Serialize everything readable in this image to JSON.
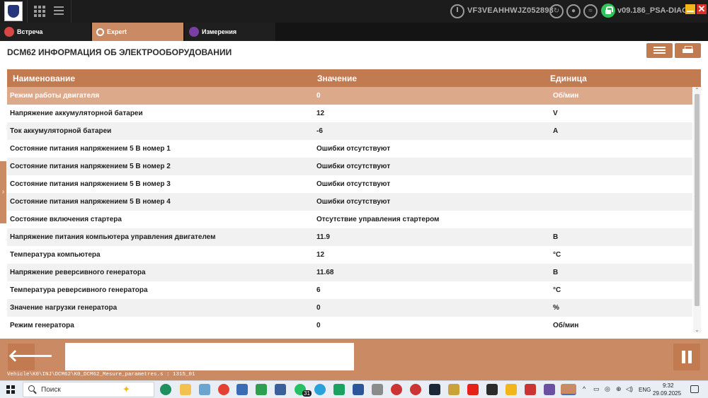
{
  "topbar": {
    "vin": "VF3VEAHHWJZ052893",
    "version": "v09.186_PSA-DIAG",
    "close_glyph": "✕"
  },
  "tabs": [
    {
      "label": "Встреча",
      "icon": "house-icon"
    },
    {
      "label": "Expert",
      "icon": "gears-icon"
    },
    {
      "label": "Измерения",
      "icon": "waveform-icon"
    }
  ],
  "page": {
    "title": "DCM62 ИНФОРМАЦИЯ ОБ ЭЛЕКТРООБОРУДОВАНИИ"
  },
  "table": {
    "headers": {
      "name": "Наименование",
      "value": "Значение",
      "unit": "Единица"
    },
    "rows": [
      {
        "name": "Режим работы двигателя",
        "value": "0",
        "unit": "Об/мин"
      },
      {
        "name": "Напряжение аккумуляторной батареи",
        "value": "12",
        "unit": "V"
      },
      {
        "name": "Ток аккумуляторной батареи",
        "value": "-6",
        "unit": "A"
      },
      {
        "name": "Состояние питания напряжением 5 В номер 1",
        "value": "Ошибки отсутствуют",
        "unit": ""
      },
      {
        "name": "Состояние питания напряжением 5 В номер 2",
        "value": "Ошибки отсутствуют",
        "unit": ""
      },
      {
        "name": "Состояние питания напряжением 5 В номер 3",
        "value": "Ошибки отсутствуют",
        "unit": ""
      },
      {
        "name": "Состояние питания напряжением 5 В номер 4",
        "value": "Ошибки отсутствуют",
        "unit": ""
      },
      {
        "name": "Состояние включения стартера",
        "value": "Отсутствие управления стартером",
        "unit": ""
      },
      {
        "name": "Напряжение питания компьютера управления двигателем",
        "value": "11.9",
        "unit": "В"
      },
      {
        "name": "Температура компьютера",
        "value": "12",
        "unit": "°C"
      },
      {
        "name": "Напряжение реверсивного генератора",
        "value": "11.68",
        "unit": "В"
      },
      {
        "name": "Температура реверсивного генератора",
        "value": "6",
        "unit": "°C"
      },
      {
        "name": "Значение нагрузки генератора",
        "value": "0",
        "unit": "%"
      },
      {
        "name": "Режим генератора",
        "value": "0",
        "unit": "Об/мин"
      }
    ]
  },
  "bottom": {
    "back_glyph": "🡐",
    "path": "Vehicle\\K0\\INJ\\DCM62\\K0_DCM62_Mesure_parametres.s : 1315_01"
  },
  "taskbar": {
    "search_placeholder": "Поиск",
    "badge": "31",
    "lang": "ENG",
    "time": "9:32",
    "date": "29.09.2025"
  },
  "colors": {
    "accent": "#c27a50",
    "accent_light": "#c98a64",
    "selected_row": "#dca98b",
    "topbar": "#1c1c1c"
  }
}
